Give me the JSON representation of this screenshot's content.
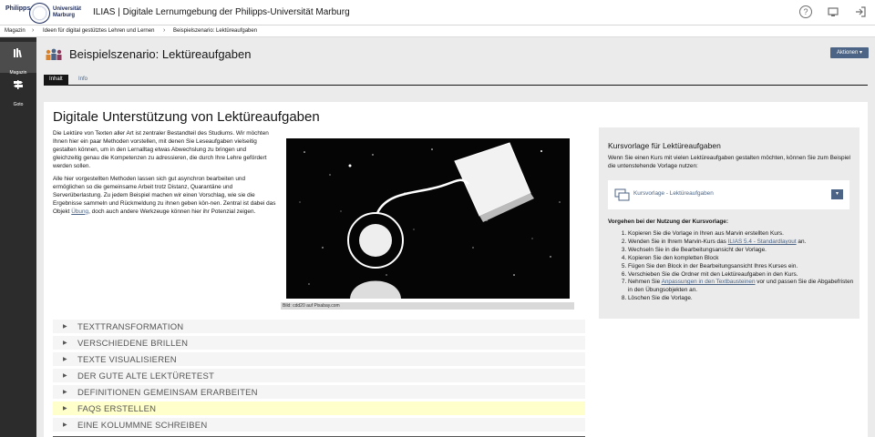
{
  "header": {
    "logo_word1": "Philipps",
    "logo_word2": "Universität",
    "logo_word3": "Marburg",
    "title": "ILIAS | Digitale Lernumgebung der Philipps-Universität Marburg",
    "icons": [
      "help-icon",
      "screen-icon",
      "logout-icon"
    ]
  },
  "breadcrumb": [
    "Magazin",
    "Ideen für digital gestütztes Lehren und Lernen",
    "Beispielszenario: Lektüreaufgaben"
  ],
  "mainbar": [
    {
      "label": "Magazin",
      "icon": "magazine-icon",
      "active": true
    },
    {
      "label": "Goto",
      "icon": "signpost-icon",
      "active": false
    }
  ],
  "page": {
    "title": "Beispielszenario: Lektüreaufgaben",
    "actions_label": "Aktionen ▾",
    "tabs": [
      "Inhalt",
      "Info"
    ]
  },
  "content": {
    "heading": "Digitale Unterstützung von Lektüreaufgaben",
    "para1": "Die Lektüre von Texten aller Art ist zentraler Bestandteil des Studiums. Wir möchten Ihnen hier ein paar Methoden vorstellen, mit denen Sie Leseaufgaben vielseitig gestalten können, um in den Lernalltag etwas Abwechslung zu bringen und gleichzeitig genau die Kompetenzen zu adressieren, die durch Ihre Lehre gefördert werden sollen.",
    "para2_a": "Alle hier vorgestellten Methoden lassen sich gut asynchron bearbeiten und ermöglichen so die gemeinsame Arbeit trotz Distanz, Quarantäne und Serverüberlastung. Zu jedem Beispiel machen wir einen Vorschlag, wie sie die Ergebnisse sammeln und Rückmeldung zu ihnen geben kön-nen. Zentral ist dabei das Objekt ",
    "para2_link": "Übung",
    "para2_b": ", doch auch andere Werkzeuge können hier ihr Potenzial zeigen.",
    "image_caption": "Bild: cdd20 auf Pixabay.com",
    "accordion": [
      "TEXTTRANSFORMATION",
      "VERSCHIEDENE BRILLEN",
      "TEXTE VISUALISIEREN",
      "DER GUTE ALTE LEKTÜRETEST",
      "DEFINITIONEN GEMEINSAM ERARBEITEN",
      "FAQS ERSTELLEN",
      "EINE KOLUMMNE SCHREIBEN"
    ],
    "accordion_highlight_index": 5
  },
  "sidebar": {
    "heading": "Kursvorlage für Lektüreaufgaben",
    "intro": "Wenn Sie einen Kurs mit vielen Lektüreaufgaben gestalten möchten, können Sie zum Beispiel die untenstehende Vorlage nutzen:",
    "template_label": "Kursvorlage - Lektüreaufgaben",
    "steps_heading": "Vorgehen bei der Nutzung der Kursvorlage:",
    "steps": [
      {
        "pre": "Kopieren Sie die Vorlage in Ihren aus Marvin erstellten Kurs.",
        "link": "",
        "post": ""
      },
      {
        "pre": "Wenden Sie in Ihrem Marvin-Kurs das ",
        "link": "ILIAS 5.4 - Standardlayout",
        "post": " an."
      },
      {
        "pre": "Wechseln Sie in die Bearbeitungsansicht der Vorlage.",
        "link": "",
        "post": ""
      },
      {
        "pre": "Kopieren Sie den kompletten Block",
        "link": "",
        "post": ""
      },
      {
        "pre": "Fügen Sie den Block in der Bearbeitungsansicht Ihres Kurses ein.",
        "link": "",
        "post": ""
      },
      {
        "pre": "Verschieben Sie die Ordner mit den Lektüreaufgaben in den Kurs.",
        "link": "",
        "post": ""
      },
      {
        "pre": "Nehmen Sie ",
        "link": "Anpassungen in den Textbausteinen",
        "post": " vor und passen Sie die Abgabefristen in den Übungsobjekten an."
      },
      {
        "pre": "Löschen Sie die Vorlage.",
        "link": "",
        "post": ""
      }
    ]
  },
  "colors": {
    "accent": "#4c6586",
    "mainbar": "#2c2c2c",
    "highlight": "#ffffcc"
  }
}
